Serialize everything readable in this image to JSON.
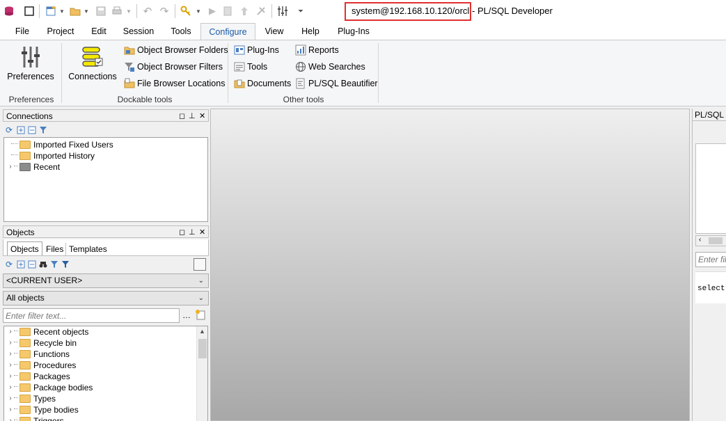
{
  "titlebar": {
    "connection": "system@192.168.10.120/orcl",
    "app_suffix": "- PL/SQL Developer"
  },
  "menu": [
    "File",
    "Project",
    "Edit",
    "Session",
    "Tools",
    "Configure",
    "View",
    "Help",
    "Plug-Ins"
  ],
  "ribbon": {
    "preferences": {
      "button": "Preferences",
      "group": "Preferences"
    },
    "dockable": {
      "connections": "Connections",
      "items": [
        "Object Browser Folders",
        "Object Browser Filters",
        "File Browser Locations"
      ],
      "group": "Dockable tools"
    },
    "other": {
      "col1": [
        "Plug-Ins",
        "Tools",
        "Documents"
      ],
      "col2": [
        "Reports",
        "Web Searches",
        "PL/SQL Beautifier"
      ],
      "group": "Other tools"
    }
  },
  "connections_panel": {
    "title": "Connections",
    "items": [
      "Imported Fixed Users",
      "Imported History",
      "Recent"
    ]
  },
  "objects_panel": {
    "title": "Objects",
    "tabs": [
      "Objects",
      "Files",
      "Templates"
    ],
    "user_select": "<CURRENT USER>",
    "filter_select": "All objects",
    "filter_placeholder": "Enter filter text...",
    "items": [
      "Recent objects",
      "Recycle bin",
      "Functions",
      "Procedures",
      "Packages",
      "Package bodies",
      "Types",
      "Type bodies",
      "Triggers"
    ]
  },
  "right_panel": {
    "title": "PL/SQL C",
    "filter_placeholder": "Enter fil",
    "text": "select"
  },
  "colors": {
    "accent": "#1a5aa6",
    "highlight": "#e03030"
  }
}
